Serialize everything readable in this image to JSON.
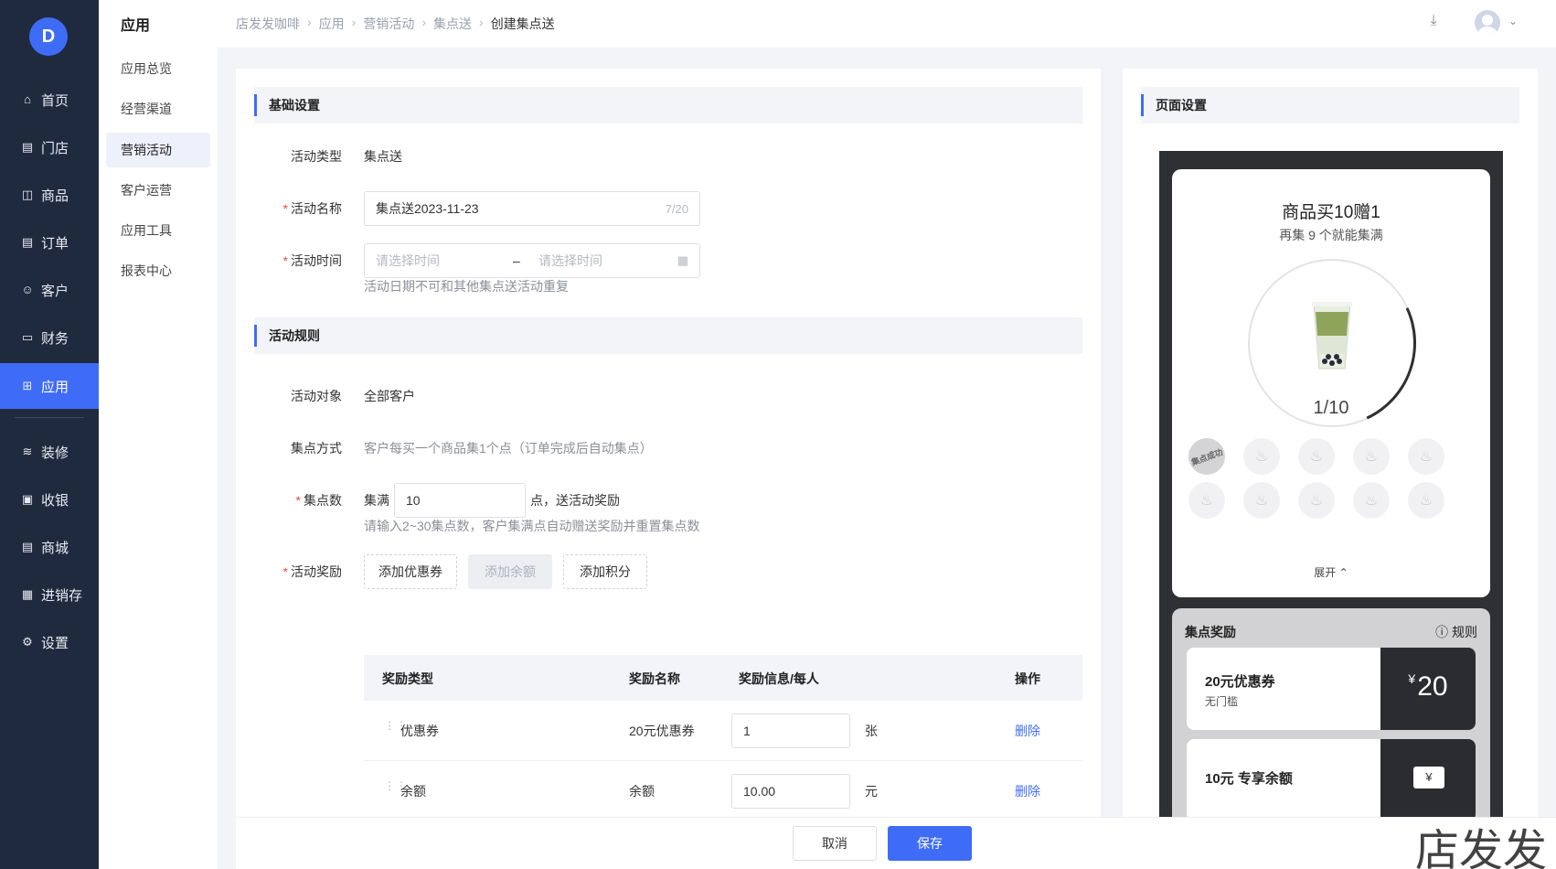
{
  "sidebar": {
    "logo": "D",
    "items": [
      {
        "label": "首页",
        "icon": "home-icon",
        "glyph": "⌂"
      },
      {
        "label": "门店",
        "icon": "store-icon",
        "glyph": "▤"
      },
      {
        "label": "商品",
        "icon": "bag-icon",
        "glyph": "◫"
      },
      {
        "label": "订单",
        "icon": "order-icon",
        "glyph": "▤"
      },
      {
        "label": "客户",
        "icon": "user-icon",
        "glyph": "☺"
      },
      {
        "label": "财务",
        "icon": "wallet-icon",
        "glyph": "▭"
      },
      {
        "label": "应用",
        "icon": "apps-icon",
        "glyph": "⊞"
      },
      {
        "label": "装修",
        "icon": "layers-icon",
        "glyph": "≋"
      },
      {
        "label": "收银",
        "icon": "cashier-icon",
        "glyph": "▣"
      },
      {
        "label": "商城",
        "icon": "shop-icon",
        "glyph": "▤"
      },
      {
        "label": "进销存",
        "icon": "inventory-icon",
        "glyph": "▦"
      },
      {
        "label": "设置",
        "icon": "settings-icon",
        "glyph": "⚙"
      }
    ]
  },
  "subnav": {
    "title": "应用",
    "items": [
      "应用总览",
      "经营渠道",
      "营销活动",
      "客户运营",
      "应用工具",
      "报表中心"
    ]
  },
  "header": {
    "breadcrumb": [
      "店发发咖啡",
      "应用",
      "营销活动",
      "集点送",
      "创建集点送"
    ]
  },
  "form": {
    "basic_title": "基础设置",
    "type_label": "活动类型",
    "type_value": "集点送",
    "name_label": "活动名称",
    "name_value": "集点送2023-11-23",
    "name_count": "7/20",
    "time_label": "活动时间",
    "time_start_ph": "请选择时间",
    "time_sep": "–",
    "time_end_ph": "请选择时间",
    "time_hint": "活动日期不可和其他集点送活动重复",
    "rules_title": "活动规则",
    "target_label": "活动对象",
    "target_value": "全部客户",
    "method_label": "集点方式",
    "method_value": "客户每买一个商品集1个点（订单完成后自动集点）",
    "points_label": "集点数",
    "points_prefix": "集满",
    "points_value": "10",
    "points_suffix": "点，送活动奖励",
    "points_hint": "请输入2~30集点数，客户集满点自动赠送奖励并重置集点数",
    "reward_label": "活动奖励",
    "btn_coupon": "添加优惠券",
    "btn_balance": "添加余额",
    "btn_points": "添加积分",
    "table": {
      "headers": [
        "奖励类型",
        "奖励名称",
        "奖励信息/每人",
        "操作"
      ],
      "rows": [
        {
          "type": "优惠券",
          "name": "20元优惠券",
          "qty": "1",
          "unit": "张",
          "action": "删除"
        },
        {
          "type": "余额",
          "name": "余额",
          "qty": "10.00",
          "unit": "元",
          "action": "删除"
        }
      ]
    }
  },
  "footer": {
    "cancel": "取消",
    "save": "保存"
  },
  "preview": {
    "title": "页面设置",
    "product_title": "商品买10赠1",
    "remain": "再集 9 个就能集满",
    "progress": "1/10",
    "progress_fraction": 0.1,
    "stamp_done": "集点成功",
    "expand": "展开 ⌃",
    "reward_title": "集点奖励",
    "rule": "规则",
    "coupon": {
      "name": "20元优惠券",
      "desc": "无门槛",
      "currency": "¥",
      "amount": "20"
    },
    "balance": {
      "name": "10元 专享余额",
      "icon": "¥"
    }
  },
  "watermark": "店发发",
  "colors": {
    "primary": "#3f6cf6",
    "sidebar": "#1f2a3f",
    "required": "#e84c3d"
  }
}
